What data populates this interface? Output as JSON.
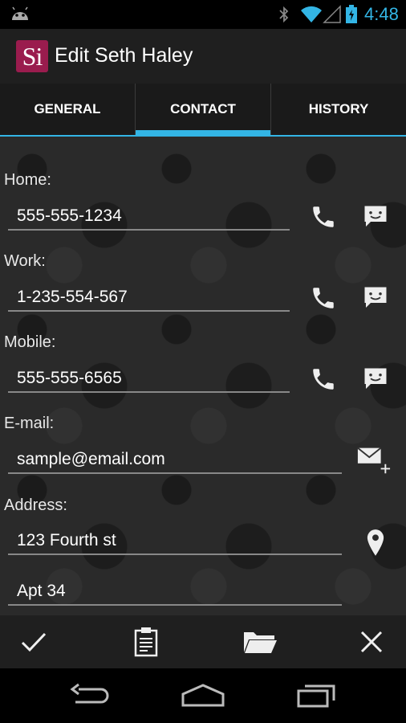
{
  "status_bar": {
    "time": "4:48",
    "icons": [
      "android-notification-icon",
      "bluetooth-icon",
      "wifi-icon",
      "signal-icon",
      "battery-icon"
    ],
    "accent_color": "#33b5e5"
  },
  "action_bar": {
    "logo_text": "Si",
    "logo_color": "#9a1c4e",
    "title": "Edit Seth Haley"
  },
  "tabs": [
    {
      "label": "GENERAL",
      "active": false
    },
    {
      "label": "CONTACT",
      "active": true
    },
    {
      "label": "HISTORY",
      "active": false
    }
  ],
  "form": {
    "home": {
      "label": "Home:",
      "value": "555-555-1234"
    },
    "work": {
      "label": "Work:",
      "value": "1-235-554-567"
    },
    "mobile": {
      "label": "Mobile:",
      "value": "555-555-6565"
    },
    "email": {
      "label": "E-mail:",
      "value": "sample@email.com"
    },
    "address": {
      "label": "Address:",
      "line1": "123 Fourth st",
      "line2": "Apt 34"
    }
  },
  "bottom_actions": [
    "check-icon",
    "clipboard-icon",
    "folder-icon",
    "close-icon"
  ],
  "nav_actions": [
    "back-icon",
    "home-icon",
    "recent-apps-icon"
  ]
}
